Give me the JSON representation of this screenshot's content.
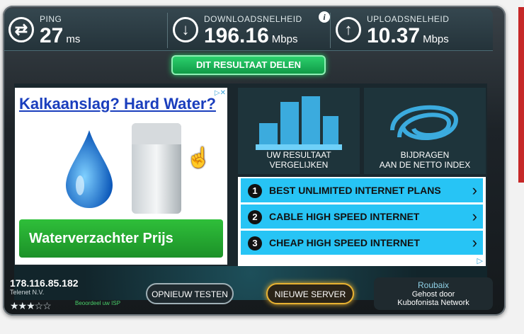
{
  "stats": {
    "ping": {
      "label": "PING",
      "value": "27",
      "unit": "ms"
    },
    "download": {
      "label": "DOWNLOADSNELHEID",
      "value": "196.16",
      "unit": "Mbps"
    },
    "upload": {
      "label": "UPLOADSNELHEID",
      "value": "10.37",
      "unit": "Mbps"
    },
    "info": "i"
  },
  "share_label": "DIT RESULTAAT DELEN",
  "ad": {
    "headline": "Kalkaanslag? Hard Water?",
    "cta": "Waterverzachter Prijs",
    "adchoice": "▷✕"
  },
  "tiles": [
    {
      "line1": "UW RESULTAAT",
      "line2": "VERGELIJKEN"
    },
    {
      "line1": "BIJDRAGEN",
      "line2": "AAN DE NETTO INDEX"
    }
  ],
  "sponsored_links": [
    {
      "num": "1",
      "label": "BEST UNLIMITED INTERNET PLANS"
    },
    {
      "num": "2",
      "label": "CABLE HIGH SPEED INTERNET"
    },
    {
      "num": "3",
      "label": "CHEAP HIGH SPEED INTERNET"
    }
  ],
  "links_adchoice": "▷",
  "isp": {
    "ip": "178.116.85.182",
    "name": "Telenet N.V.",
    "rating_text": "Beoordeel uw ISP",
    "stars": 3,
    "max_stars": 5
  },
  "buttons": {
    "retest": "OPNIEUW TESTEN",
    "new_server": "NIEUWE SERVER"
  },
  "server": {
    "city": "Roubaix",
    "hosted": "Gehost door",
    "host": "Kubofonista Network"
  },
  "colors": {
    "accent_green": "#1ec75f",
    "link_blue": "#27c4f5",
    "server_gold": "#e8b232"
  }
}
